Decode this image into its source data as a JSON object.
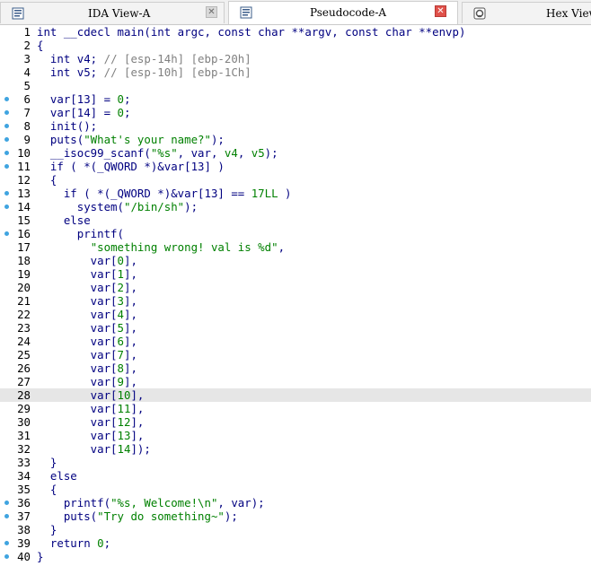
{
  "tabs": [
    {
      "label": "IDA View-A",
      "icon": "view-icon",
      "close": "grey"
    },
    {
      "label": "Pseudocode-A",
      "icon": "pseudocode-icon",
      "close": "red"
    },
    {
      "label": "Hex View-",
      "icon": "hex-view-icon",
      "close": null
    }
  ],
  "code": {
    "highlighted_line": 28,
    "lines": [
      {
        "n": "1",
        "dot": false,
        "parts": [
          [
            "p",
            "int __cdecl main(int argc, const char **argv, const char **envp)"
          ]
        ]
      },
      {
        "n": "2",
        "dot": false,
        "parts": [
          [
            "p",
            "{"
          ]
        ]
      },
      {
        "n": "3",
        "dot": false,
        "parts": [
          [
            "p",
            "  int v4; "
          ],
          [
            "c",
            "// [esp-14h] [ebp-20h]"
          ]
        ]
      },
      {
        "n": "4",
        "dot": false,
        "parts": [
          [
            "p",
            "  int v5; "
          ],
          [
            "c",
            "// [esp-10h] [ebp-1Ch]"
          ]
        ]
      },
      {
        "n": "5",
        "dot": false,
        "parts": [
          [
            "p",
            ""
          ]
        ]
      },
      {
        "n": "6",
        "dot": true,
        "parts": [
          [
            "p",
            "  var[13] = "
          ],
          [
            "n",
            "0"
          ],
          [
            "p",
            ";"
          ]
        ]
      },
      {
        "n": "7",
        "dot": true,
        "parts": [
          [
            "p",
            "  var[14] = "
          ],
          [
            "n",
            "0"
          ],
          [
            "p",
            ";"
          ]
        ]
      },
      {
        "n": "8",
        "dot": true,
        "parts": [
          [
            "p",
            "  init();"
          ]
        ]
      },
      {
        "n": "9",
        "dot": true,
        "parts": [
          [
            "p",
            "  puts("
          ],
          [
            "s",
            "\"What's your name?\""
          ],
          [
            "p",
            ");"
          ]
        ]
      },
      {
        "n": "10",
        "dot": true,
        "parts": [
          [
            "p",
            "  __isoc99_scanf("
          ],
          [
            "s",
            "\"%s\""
          ],
          [
            "p",
            ", var, "
          ],
          [
            "n",
            "v4"
          ],
          [
            "p",
            ", "
          ],
          [
            "n",
            "v5"
          ],
          [
            "p",
            ");"
          ]
        ]
      },
      {
        "n": "11",
        "dot": true,
        "parts": [
          [
            "p",
            "  if ( *(_QWORD *)&var[13] )"
          ]
        ]
      },
      {
        "n": "12",
        "dot": false,
        "parts": [
          [
            "p",
            "  {"
          ]
        ]
      },
      {
        "n": "13",
        "dot": true,
        "parts": [
          [
            "p",
            "    if ( *(_QWORD *)&var[13] == "
          ],
          [
            "n",
            "17LL"
          ],
          [
            "p",
            " )"
          ]
        ]
      },
      {
        "n": "14",
        "dot": true,
        "parts": [
          [
            "p",
            "      system("
          ],
          [
            "s",
            "\"/bin/sh\""
          ],
          [
            "p",
            ");"
          ]
        ]
      },
      {
        "n": "15",
        "dot": false,
        "parts": [
          [
            "p",
            "    else"
          ]
        ]
      },
      {
        "n": "16",
        "dot": true,
        "parts": [
          [
            "p",
            "      printf("
          ]
        ]
      },
      {
        "n": "17",
        "dot": false,
        "parts": [
          [
            "p",
            "        "
          ],
          [
            "s",
            "\"something wrong! val is %d\""
          ],
          [
            "p",
            ","
          ]
        ]
      },
      {
        "n": "18",
        "dot": false,
        "parts": [
          [
            "p",
            "        var["
          ],
          [
            "n",
            "0"
          ],
          [
            "p",
            "],"
          ]
        ]
      },
      {
        "n": "19",
        "dot": false,
        "parts": [
          [
            "p",
            "        var["
          ],
          [
            "n",
            "1"
          ],
          [
            "p",
            "],"
          ]
        ]
      },
      {
        "n": "20",
        "dot": false,
        "parts": [
          [
            "p",
            "        var["
          ],
          [
            "n",
            "2"
          ],
          [
            "p",
            "],"
          ]
        ]
      },
      {
        "n": "21",
        "dot": false,
        "parts": [
          [
            "p",
            "        var["
          ],
          [
            "n",
            "3"
          ],
          [
            "p",
            "],"
          ]
        ]
      },
      {
        "n": "22",
        "dot": false,
        "parts": [
          [
            "p",
            "        var["
          ],
          [
            "n",
            "4"
          ],
          [
            "p",
            "],"
          ]
        ]
      },
      {
        "n": "23",
        "dot": false,
        "parts": [
          [
            "p",
            "        var["
          ],
          [
            "n",
            "5"
          ],
          [
            "p",
            "],"
          ]
        ]
      },
      {
        "n": "24",
        "dot": false,
        "parts": [
          [
            "p",
            "        var["
          ],
          [
            "n",
            "6"
          ],
          [
            "p",
            "],"
          ]
        ]
      },
      {
        "n": "25",
        "dot": false,
        "parts": [
          [
            "p",
            "        var["
          ],
          [
            "n",
            "7"
          ],
          [
            "p",
            "],"
          ]
        ]
      },
      {
        "n": "26",
        "dot": false,
        "parts": [
          [
            "p",
            "        var["
          ],
          [
            "n",
            "8"
          ],
          [
            "p",
            "],"
          ]
        ]
      },
      {
        "n": "27",
        "dot": false,
        "parts": [
          [
            "p",
            "        var["
          ],
          [
            "n",
            "9"
          ],
          [
            "p",
            "],"
          ]
        ]
      },
      {
        "n": "28",
        "dot": false,
        "parts": [
          [
            "p",
            "        var["
          ],
          [
            "n",
            "10"
          ],
          [
            "p",
            "],"
          ]
        ]
      },
      {
        "n": "29",
        "dot": false,
        "parts": [
          [
            "p",
            "        var["
          ],
          [
            "n",
            "11"
          ],
          [
            "p",
            "],"
          ]
        ]
      },
      {
        "n": "30",
        "dot": false,
        "parts": [
          [
            "p",
            "        var["
          ],
          [
            "n",
            "12"
          ],
          [
            "p",
            "],"
          ]
        ]
      },
      {
        "n": "31",
        "dot": false,
        "parts": [
          [
            "p",
            "        var["
          ],
          [
            "n",
            "13"
          ],
          [
            "p",
            "],"
          ]
        ]
      },
      {
        "n": "32",
        "dot": false,
        "parts": [
          [
            "p",
            "        var["
          ],
          [
            "n",
            "14"
          ],
          [
            "p",
            "]);"
          ]
        ]
      },
      {
        "n": "33",
        "dot": false,
        "parts": [
          [
            "p",
            "  }"
          ]
        ]
      },
      {
        "n": "34",
        "dot": false,
        "parts": [
          [
            "p",
            "  else"
          ]
        ]
      },
      {
        "n": "35",
        "dot": false,
        "parts": [
          [
            "p",
            "  {"
          ]
        ]
      },
      {
        "n": "36",
        "dot": true,
        "parts": [
          [
            "p",
            "    printf("
          ],
          [
            "s",
            "\"%s, Welcome!\\n\""
          ],
          [
            "p",
            ", var);"
          ]
        ]
      },
      {
        "n": "37",
        "dot": true,
        "parts": [
          [
            "p",
            "    puts("
          ],
          [
            "s",
            "\"Try do something~\""
          ],
          [
            "p",
            ");"
          ]
        ]
      },
      {
        "n": "38",
        "dot": false,
        "parts": [
          [
            "p",
            "  }"
          ]
        ]
      },
      {
        "n": "39",
        "dot": true,
        "parts": [
          [
            "p",
            "  return "
          ],
          [
            "n",
            "0"
          ],
          [
            "p",
            ";"
          ]
        ]
      },
      {
        "n": "40",
        "dot": true,
        "parts": [
          [
            "p",
            "}"
          ]
        ]
      }
    ]
  }
}
